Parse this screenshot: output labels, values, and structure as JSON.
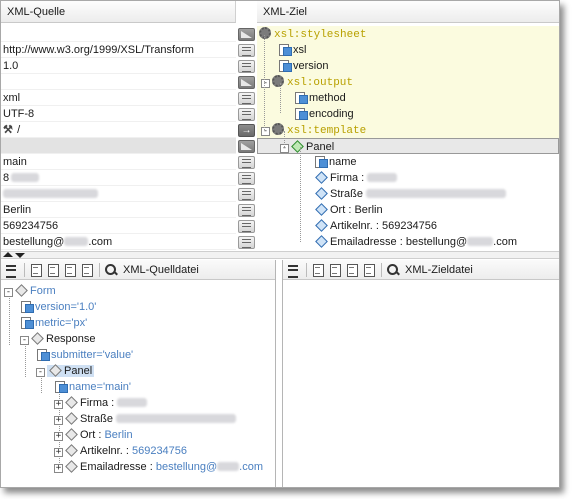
{
  "top": {
    "source_header": "XML-Quelle",
    "target_header": "XML-Ziel",
    "source_rows": [
      {
        "text": ""
      },
      {
        "text": "http://www.w3.org/1999/XSL/Transform"
      },
      {
        "text": "1.0"
      },
      {
        "text": ""
      },
      {
        "text": "xml"
      },
      {
        "text": "UTF-8"
      },
      {
        "text": "/"
      },
      {
        "text": ""
      },
      {
        "text": "main"
      },
      {
        "text": "8"
      },
      {
        "text": ""
      },
      {
        "text": "Berlin"
      },
      {
        "text": "569234756"
      },
      {
        "text": "bestellung@"
      },
      {
        "text": ".com"
      }
    ],
    "target_rows": {
      "stylesheet": "xsl:stylesheet",
      "xsl_attr": "xsl",
      "version": "version",
      "output": "xsl:output",
      "method": "method",
      "encoding": "encoding",
      "template": "xsl:template",
      "panel": "Panel",
      "name": "name",
      "firma_label": "Firma :",
      "strasse_label": "Straße",
      "ort_label": "Ort :",
      "ort_value": "Berlin",
      "artikel_label": "Artikelnr. :",
      "artikel_value": "569234756",
      "email_label": "Emailadresse :",
      "email_value_a": "bestellung@",
      "email_value_b": ".com"
    }
  },
  "bottom_left": {
    "toolbar_label": "XML-Quelldatei",
    "tree": {
      "form": "Form",
      "version_attr": "version='1.0'",
      "metric_attr": "metric='px'",
      "response": "Response",
      "submitter_attr": "submitter='value'",
      "panel": "Panel",
      "name_attr": "name='main'",
      "firma": "Firma :",
      "strasse": "Straße",
      "ort": "Ort :",
      "ort_value": "Berlin",
      "artikel": "Artikelnr. :",
      "artikel_value": "569234756",
      "email": "Emailadresse :",
      "email_value_a": "bestellung@",
      "email_value_b": ".com"
    }
  },
  "bottom_right": {
    "toolbar_label": "XML-Zieldatei"
  },
  "colors": {
    "xsl_keyword": "#b8a000",
    "xsl_row_bg": "#fbfbdf",
    "attr_value": "#4a7fc0"
  }
}
